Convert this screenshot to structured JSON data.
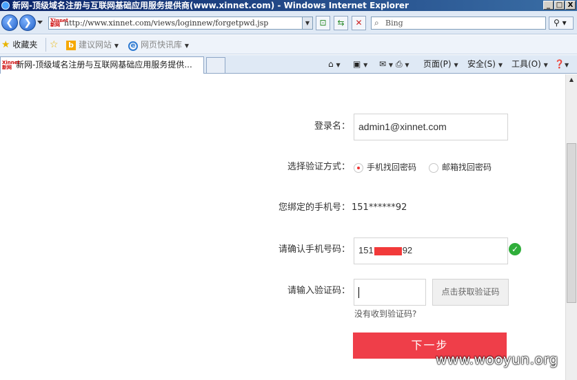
{
  "window": {
    "title": "新网-顶级域名注册与互联网基础应用服务提供商(www.xinnet.com) - Windows Internet Explorer",
    "min": "_",
    "max": "□",
    "close": "X"
  },
  "address": {
    "url": "http://www.xinnet.com/views/loginnew/forgetpwd.jsp",
    "search_placeholder": "Bing",
    "favicon_text": "Xinnet新网"
  },
  "favorites_bar": {
    "favorites_label": "收藏夹",
    "suggested_sites": "建议网站",
    "web_slice_gallery": "网页快讯库"
  },
  "tabs": [
    {
      "label": "新网-顶级域名注册与互联网基础应用服务提供..."
    }
  ],
  "command_bar": {
    "page": "页面(P)",
    "safety": "安全(S)",
    "tools": "工具(O)"
  },
  "form": {
    "login_label": "登录名：",
    "login_value": "admin1@xinnet.com",
    "verify_method_label": "选择验证方式：",
    "options": [
      {
        "label": "手机找回密码",
        "selected": true
      },
      {
        "label": "邮箱找回密码",
        "selected": false
      }
    ],
    "bound_phone_label": "您绑定的手机号：",
    "bound_phone_value": "151******92",
    "confirm_phone_label": "请确认手机号码：",
    "confirm_phone_prefix": "151",
    "confirm_phone_suffix": "92",
    "code_label": "请输入验证码：",
    "get_code_button": "点击获取验证码",
    "no_code_link": "没有收到验证码?",
    "next_button": "下一步"
  },
  "watermark": "www.wooyun.org",
  "colors": {
    "primary_button": "#ef3e49",
    "success": "#2fae3a",
    "redaction": "#f23a3a"
  }
}
